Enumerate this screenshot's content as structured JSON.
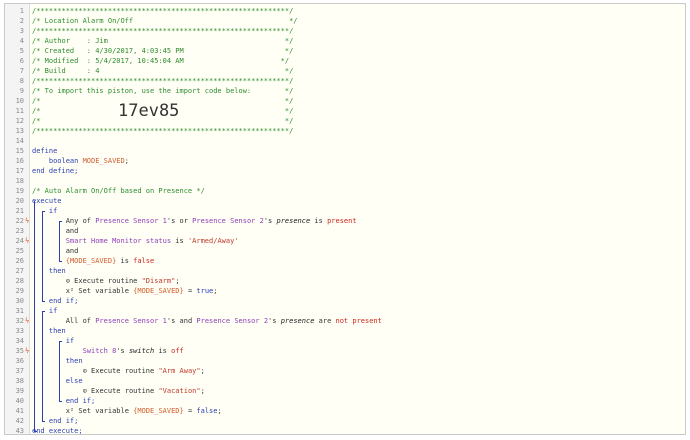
{
  "lines": [
    {
      "n": "1",
      "segments": [
        {
          "c": "cm",
          "t": "/************************************************************/"
        }
      ]
    },
    {
      "n": "2",
      "segments": [
        {
          "c": "cm",
          "t": "/* Location Alarm On/Off                                     */"
        }
      ]
    },
    {
      "n": "3",
      "segments": [
        {
          "c": "cm",
          "t": "/************************************************************/"
        }
      ]
    },
    {
      "n": "4",
      "segments": [
        {
          "c": "cm",
          "t": "/* Author    : Jim                                          */"
        }
      ]
    },
    {
      "n": "5",
      "segments": [
        {
          "c": "cm",
          "t": "/* Created   : 4/30/2017, 4:03:45 PM                        */"
        }
      ]
    },
    {
      "n": "6",
      "segments": [
        {
          "c": "cm",
          "t": "/* Modified  : 5/4/2017, 10:45:04 AM                       */"
        }
      ]
    },
    {
      "n": "7",
      "segments": [
        {
          "c": "cm",
          "t": "/* Build     : 4                                            */"
        }
      ]
    },
    {
      "n": "8",
      "segments": [
        {
          "c": "cm",
          "t": "/************************************************************/"
        }
      ]
    },
    {
      "n": "9",
      "segments": [
        {
          "c": "cm",
          "t": "/* To import this piston, use the import code below:        */"
        }
      ]
    },
    {
      "n": "10",
      "segments": [
        {
          "c": "cm",
          "t": "/*                                                          */"
        }
      ]
    },
    {
      "n": "11",
      "segments": [
        {
          "c": "cm",
          "t": "/*                                                          */"
        }
      ]
    },
    {
      "n": "12",
      "segments": [
        {
          "c": "cm",
          "t": "/*                                                          */"
        }
      ]
    },
    {
      "n": "13",
      "segments": [
        {
          "c": "cm",
          "t": "/************************************************************/"
        }
      ]
    },
    {
      "n": "14",
      "segments": []
    },
    {
      "n": "15",
      "segments": [
        {
          "c": "kw",
          "t": "define"
        }
      ]
    },
    {
      "n": "16",
      "segments": [
        {
          "c": "",
          "t": "    "
        },
        {
          "c": "ty",
          "t": "boolean"
        },
        {
          "c": "",
          "t": " "
        },
        {
          "c": "var",
          "t": "MODE_SAVED"
        },
        {
          "c": "",
          "t": ";"
        }
      ]
    },
    {
      "n": "17",
      "segments": [
        {
          "c": "kw",
          "t": "end define;"
        }
      ]
    },
    {
      "n": "18",
      "segments": []
    },
    {
      "n": "19",
      "segments": [
        {
          "c": "cm",
          "t": "/* Auto Alarm On/Off based on Presence */"
        }
      ]
    },
    {
      "n": "20",
      "segments": [
        {
          "c": "kw",
          "t": "execute"
        }
      ]
    },
    {
      "n": "21",
      "segments": [
        {
          "c": "",
          "t": "    "
        },
        {
          "c": "kw",
          "t": "if"
        }
      ]
    },
    {
      "n": "22",
      "segments": [
        {
          "c": "",
          "t": "        Any of "
        },
        {
          "c": "dev",
          "t": "Presence Sensor 1"
        },
        {
          "c": "",
          "t": "'s or "
        },
        {
          "c": "dev",
          "t": "Presence Sensor 2"
        },
        {
          "c": "",
          "t": "'s "
        },
        {
          "c": "attr",
          "t": "presence"
        },
        {
          "c": "",
          "t": " is "
        },
        {
          "c": "val",
          "t": "present"
        }
      ]
    },
    {
      "n": "23",
      "segments": [
        {
          "c": "",
          "t": "        and"
        }
      ]
    },
    {
      "n": "24",
      "segments": [
        {
          "c": "",
          "t": "        "
        },
        {
          "c": "dev",
          "t": "Smart Home Monitor status"
        },
        {
          "c": "",
          "t": " is "
        },
        {
          "c": "str",
          "t": "'Armed/Away'"
        }
      ]
    },
    {
      "n": "25",
      "segments": [
        {
          "c": "",
          "t": "        and"
        }
      ]
    },
    {
      "n": "26",
      "segments": [
        {
          "c": "",
          "t": "        "
        },
        {
          "c": "var",
          "t": "{MODE_SAVED}"
        },
        {
          "c": "",
          "t": " is "
        },
        {
          "c": "val",
          "t": "false"
        }
      ]
    },
    {
      "n": "27",
      "segments": [
        {
          "c": "",
          "t": "    "
        },
        {
          "c": "kw",
          "t": "then"
        }
      ]
    },
    {
      "n": "28",
      "segments": [
        {
          "c": "",
          "t": "        "
        },
        {
          "c": "icon",
          "t": "⊙"
        },
        {
          "c": "",
          "t": " Execute routine "
        },
        {
          "c": "str",
          "t": "\"Disarm\""
        },
        {
          "c": "",
          "t": ";"
        }
      ]
    },
    {
      "n": "29",
      "segments": [
        {
          "c": "",
          "t": "        x² Set variable "
        },
        {
          "c": "var",
          "t": "{MODE_SAVED}"
        },
        {
          "c": "",
          "t": " = "
        },
        {
          "c": "bool",
          "t": "true"
        },
        {
          "c": "",
          "t": ";"
        }
      ]
    },
    {
      "n": "30",
      "segments": [
        {
          "c": "",
          "t": "    "
        },
        {
          "c": "kw",
          "t": "end if;"
        }
      ]
    },
    {
      "n": "31",
      "segments": [
        {
          "c": "",
          "t": "    "
        },
        {
          "c": "kw",
          "t": "if"
        }
      ]
    },
    {
      "n": "32",
      "segments": [
        {
          "c": "",
          "t": "        All of "
        },
        {
          "c": "dev",
          "t": "Presence Sensor 1"
        },
        {
          "c": "",
          "t": "'s and "
        },
        {
          "c": "dev",
          "t": "Presence Sensor 2"
        },
        {
          "c": "",
          "t": "'s "
        },
        {
          "c": "attr",
          "t": "presence"
        },
        {
          "c": "",
          "t": " are "
        },
        {
          "c": "val",
          "t": "not present"
        }
      ]
    },
    {
      "n": "33",
      "segments": [
        {
          "c": "",
          "t": "    "
        },
        {
          "c": "kw",
          "t": "then"
        }
      ]
    },
    {
      "n": "34",
      "segments": [
        {
          "c": "",
          "t": "        "
        },
        {
          "c": "kw",
          "t": "if"
        }
      ]
    },
    {
      "n": "35",
      "segments": [
        {
          "c": "",
          "t": "            "
        },
        {
          "c": "dev",
          "t": "Switch 8"
        },
        {
          "c": "",
          "t": "'s "
        },
        {
          "c": "attr",
          "t": "switch"
        },
        {
          "c": "",
          "t": " is "
        },
        {
          "c": "val",
          "t": "off"
        }
      ]
    },
    {
      "n": "36",
      "segments": [
        {
          "c": "",
          "t": "        "
        },
        {
          "c": "kw",
          "t": "then"
        }
      ]
    },
    {
      "n": "37",
      "segments": [
        {
          "c": "",
          "t": "            "
        },
        {
          "c": "icon",
          "t": "⊙"
        },
        {
          "c": "",
          "t": " Execute routine "
        },
        {
          "c": "str",
          "t": "\"Arm Away\""
        },
        {
          "c": "",
          "t": ";"
        }
      ]
    },
    {
      "n": "38",
      "segments": [
        {
          "c": "",
          "t": "        "
        },
        {
          "c": "kw",
          "t": "else"
        }
      ]
    },
    {
      "n": "39",
      "segments": [
        {
          "c": "",
          "t": "            "
        },
        {
          "c": "icon",
          "t": "⊙"
        },
        {
          "c": "",
          "t": " Execute routine "
        },
        {
          "c": "str",
          "t": "\"Vacation\""
        },
        {
          "c": "",
          "t": ";"
        }
      ]
    },
    {
      "n": "40",
      "segments": [
        {
          "c": "",
          "t": "        "
        },
        {
          "c": "kw",
          "t": "end if;"
        }
      ]
    },
    {
      "n": "41",
      "segments": [
        {
          "c": "",
          "t": "        x² Set variable "
        },
        {
          "c": "var",
          "t": "{MODE_SAVED}"
        },
        {
          "c": "",
          "t": " = "
        },
        {
          "c": "bool",
          "t": "false"
        },
        {
          "c": "",
          "t": ";"
        }
      ]
    },
    {
      "n": "42",
      "segments": [
        {
          "c": "",
          "t": "    "
        },
        {
          "c": "kw",
          "t": "end if;"
        }
      ]
    },
    {
      "n": "43",
      "segments": [
        {
          "c": "kw",
          "t": "end execute;"
        }
      ]
    }
  ],
  "import_code": "17ev85",
  "trigger_icon": "lightning-bolt-icon",
  "trigger_lines": [
    "22",
    "24",
    "32",
    "35"
  ],
  "colors": {
    "comment": "#2d8c2d",
    "keyword": "#2b3fb2",
    "variable": "#d45d2d",
    "device": "#8e3fb8",
    "value": "#d0261c",
    "trigger": "#e0561b"
  }
}
